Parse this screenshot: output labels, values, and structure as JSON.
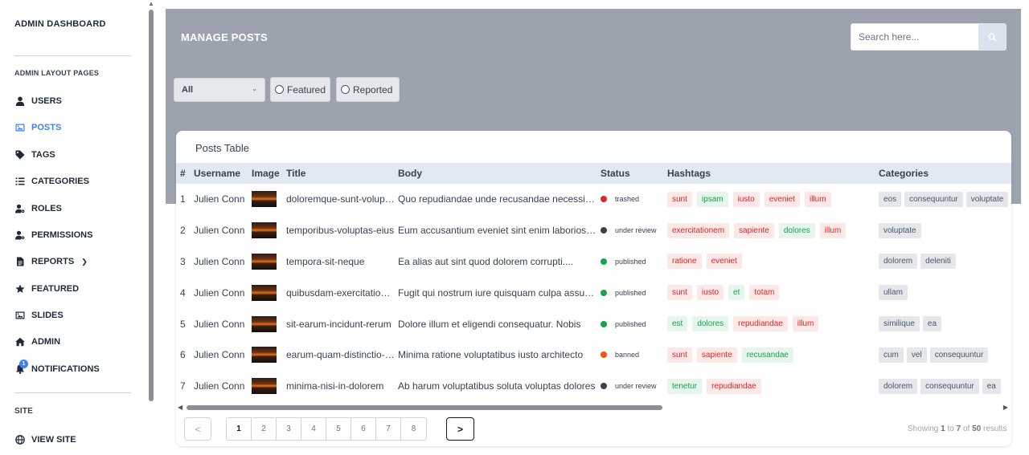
{
  "sidebar": {
    "brand": "ADMIN DASHBOARD",
    "section_pages": "ADMIN LAYOUT PAGES",
    "items": [
      {
        "label": "USERS",
        "icon": "user-icon"
      },
      {
        "label": "POSTS",
        "icon": "image-icon",
        "active": true
      },
      {
        "label": "TAGS",
        "icon": "tag-icon"
      },
      {
        "label": "CATEGORIES",
        "icon": "list-icon"
      },
      {
        "label": "ROLES",
        "icon": "user-gear-icon"
      },
      {
        "label": "PERMISSIONS",
        "icon": "user-gear-icon"
      },
      {
        "label": "REPORTS",
        "icon": "document-icon",
        "chevron": "chevron-down-icon"
      },
      {
        "label": "FEATURED",
        "icon": "star-icon"
      },
      {
        "label": "SLIDES",
        "icon": "image-icon"
      },
      {
        "label": "ADMIN",
        "icon": "home-icon"
      },
      {
        "label": "NOTIFICATIONS",
        "icon": "bell-icon",
        "badge": "1"
      }
    ],
    "section_site": "SITE",
    "site_items": [
      {
        "label": "VIEW SITE",
        "icon": "globe-icon"
      }
    ]
  },
  "header": {
    "title": "MANAGE POSTS",
    "search_placeholder": "Search here..."
  },
  "filters": {
    "select_value": "All",
    "radio_featured": "Featured",
    "radio_reported": "Reported"
  },
  "table": {
    "title": "Posts Table",
    "columns": [
      "#",
      "Username",
      "Image",
      "Title",
      "Body",
      "Status",
      "Hashtags",
      "Categories"
    ],
    "rows": [
      {
        "num": "1",
        "username": "Julien Conn",
        "title": "doloremque-sunt-voluptatem",
        "body": "Quo repudiandae unde recusandae necessitatibus",
        "status": "trashed",
        "status_color": "#dc2626",
        "hashtags": [
          {
            "t": "sunt",
            "c": "red"
          },
          {
            "t": "ipsam",
            "c": "green"
          },
          {
            "t": "iusto",
            "c": "red"
          },
          {
            "t": "eveniet",
            "c": "red"
          },
          {
            "t": "illum",
            "c": "red"
          }
        ],
        "categories": [
          "eos",
          "consequuntur",
          "voluptate"
        ]
      },
      {
        "num": "2",
        "username": "Julien Conn",
        "title": "temporibus-voluptas-eius",
        "body": "Eum accusantium eveniet sint enim laboriosam",
        "status": "under review",
        "status_color": "#374151",
        "hashtags": [
          {
            "t": "exercitationem",
            "c": "red"
          },
          {
            "t": "sapiente",
            "c": "red"
          },
          {
            "t": "dolores",
            "c": "green"
          },
          {
            "t": "illum",
            "c": "red"
          }
        ],
        "categories": [
          "voluptate"
        ]
      },
      {
        "num": "3",
        "username": "Julien Conn",
        "title": "tempora-sit-neque",
        "body": "Ea alias aut sint quod dolorem corrupti....",
        "status": "published",
        "status_color": "#16a34a",
        "hashtags": [
          {
            "t": "ratione",
            "c": "red"
          },
          {
            "t": "eveniet",
            "c": "red"
          }
        ],
        "categories": [
          "dolorem",
          "deleniti"
        ]
      },
      {
        "num": "4",
        "username": "Julien Conn",
        "title": "quibusdam-exercitationem-odio",
        "body": "Fugit qui nostrum iure quisquam culpa assumenda",
        "status": "published",
        "status_color": "#16a34a",
        "hashtags": [
          {
            "t": "sunt",
            "c": "red"
          },
          {
            "t": "iusto",
            "c": "red"
          },
          {
            "t": "et",
            "c": "green"
          },
          {
            "t": "totam",
            "c": "red"
          }
        ],
        "categories": [
          "ullam"
        ]
      },
      {
        "num": "5",
        "username": "Julien Conn",
        "title": "sit-earum-incidunt-rerum",
        "body": "Dolore illum et eligendi consequatur. Nobis",
        "status": "published",
        "status_color": "#16a34a",
        "hashtags": [
          {
            "t": "est",
            "c": "green"
          },
          {
            "t": "dolores",
            "c": "green"
          },
          {
            "t": "repudiandae",
            "c": "red"
          },
          {
            "t": "illum",
            "c": "red"
          }
        ],
        "categories": [
          "similique",
          "ea"
        ]
      },
      {
        "num": "6",
        "username": "Julien Conn",
        "title": "earum-quam-distinctio-nobis",
        "body": "Minima ratione voluptatibus iusto architecto",
        "status": "banned",
        "status_color": "#ea580c",
        "hashtags": [
          {
            "t": "sunt",
            "c": "red"
          },
          {
            "t": "sapiente",
            "c": "red"
          },
          {
            "t": "recusandae",
            "c": "green"
          }
        ],
        "categories": [
          "cum",
          "vel",
          "consequuntur"
        ]
      },
      {
        "num": "7",
        "username": "Julien Conn",
        "title": "minima-nisi-in-dolorem",
        "body": "Ab harum voluptatibus soluta voluptas dolores",
        "status": "under review",
        "status_color": "#374151",
        "hashtags": [
          {
            "t": "tenetur",
            "c": "green"
          },
          {
            "t": "repudiandae",
            "c": "red"
          }
        ],
        "categories": [
          "dolorem",
          "consequuntur",
          "ea"
        ]
      }
    ]
  },
  "pagination": {
    "prev": "<",
    "next": ">",
    "pages": [
      "1",
      "2",
      "3",
      "4",
      "5",
      "6",
      "7",
      "8"
    ],
    "current": "1",
    "summary_prefix": "Showing",
    "from": "1",
    "to_word": "to",
    "to": "7",
    "of_word": "of",
    "total": "50",
    "suffix": "results"
  },
  "colors": {
    "accent": "#3b82f6",
    "banner": "#9ca3af"
  }
}
